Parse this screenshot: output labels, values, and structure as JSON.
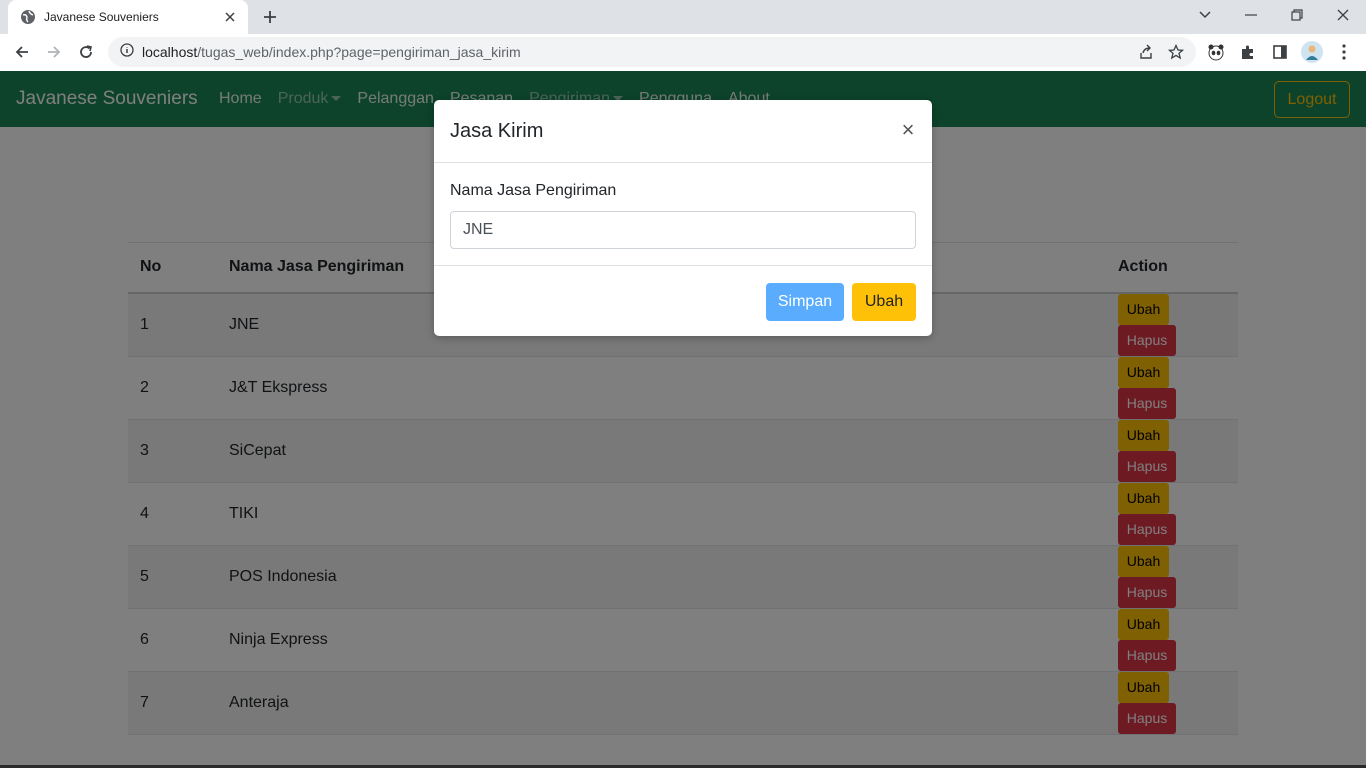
{
  "browser": {
    "tab_title": "Javanese Souveniers",
    "url_host": "localhost",
    "url_path": "/tugas_web/index.php?page=pengiriman_jasa_kirim"
  },
  "navbar": {
    "brand": "Javanese Souveniers",
    "links": [
      "Home",
      "Produk",
      "Pelanggan",
      "Pesanan",
      "Pengiriman",
      "Pengguna",
      "About"
    ],
    "logout": "Logout"
  },
  "table": {
    "headers": {
      "no": "No",
      "name": "Nama Jasa Pengiriman",
      "action": "Action"
    },
    "rows": [
      {
        "no": "1",
        "name": "JNE"
      },
      {
        "no": "2",
        "name": "J&T Ekspress"
      },
      {
        "no": "3",
        "name": "SiCepat"
      },
      {
        "no": "4",
        "name": "TIKI"
      },
      {
        "no": "5",
        "name": "POS Indonesia"
      },
      {
        "no": "6",
        "name": "Ninja Express"
      },
      {
        "no": "7",
        "name": "Anteraja"
      }
    ],
    "ubah_label": "Ubah",
    "hapus_label": "Hapus"
  },
  "modal": {
    "title": "Jasa Kirim",
    "close_glyph": "×",
    "field_label": "Nama Jasa Pengiriman",
    "field_value": "JNE",
    "simpan_label": "Simpan",
    "ubah_label": "Ubah"
  },
  "colors": {
    "navbar": "#198754",
    "warning": "#ffc107",
    "danger": "#dc3545",
    "primary_light": "#5aacff"
  }
}
